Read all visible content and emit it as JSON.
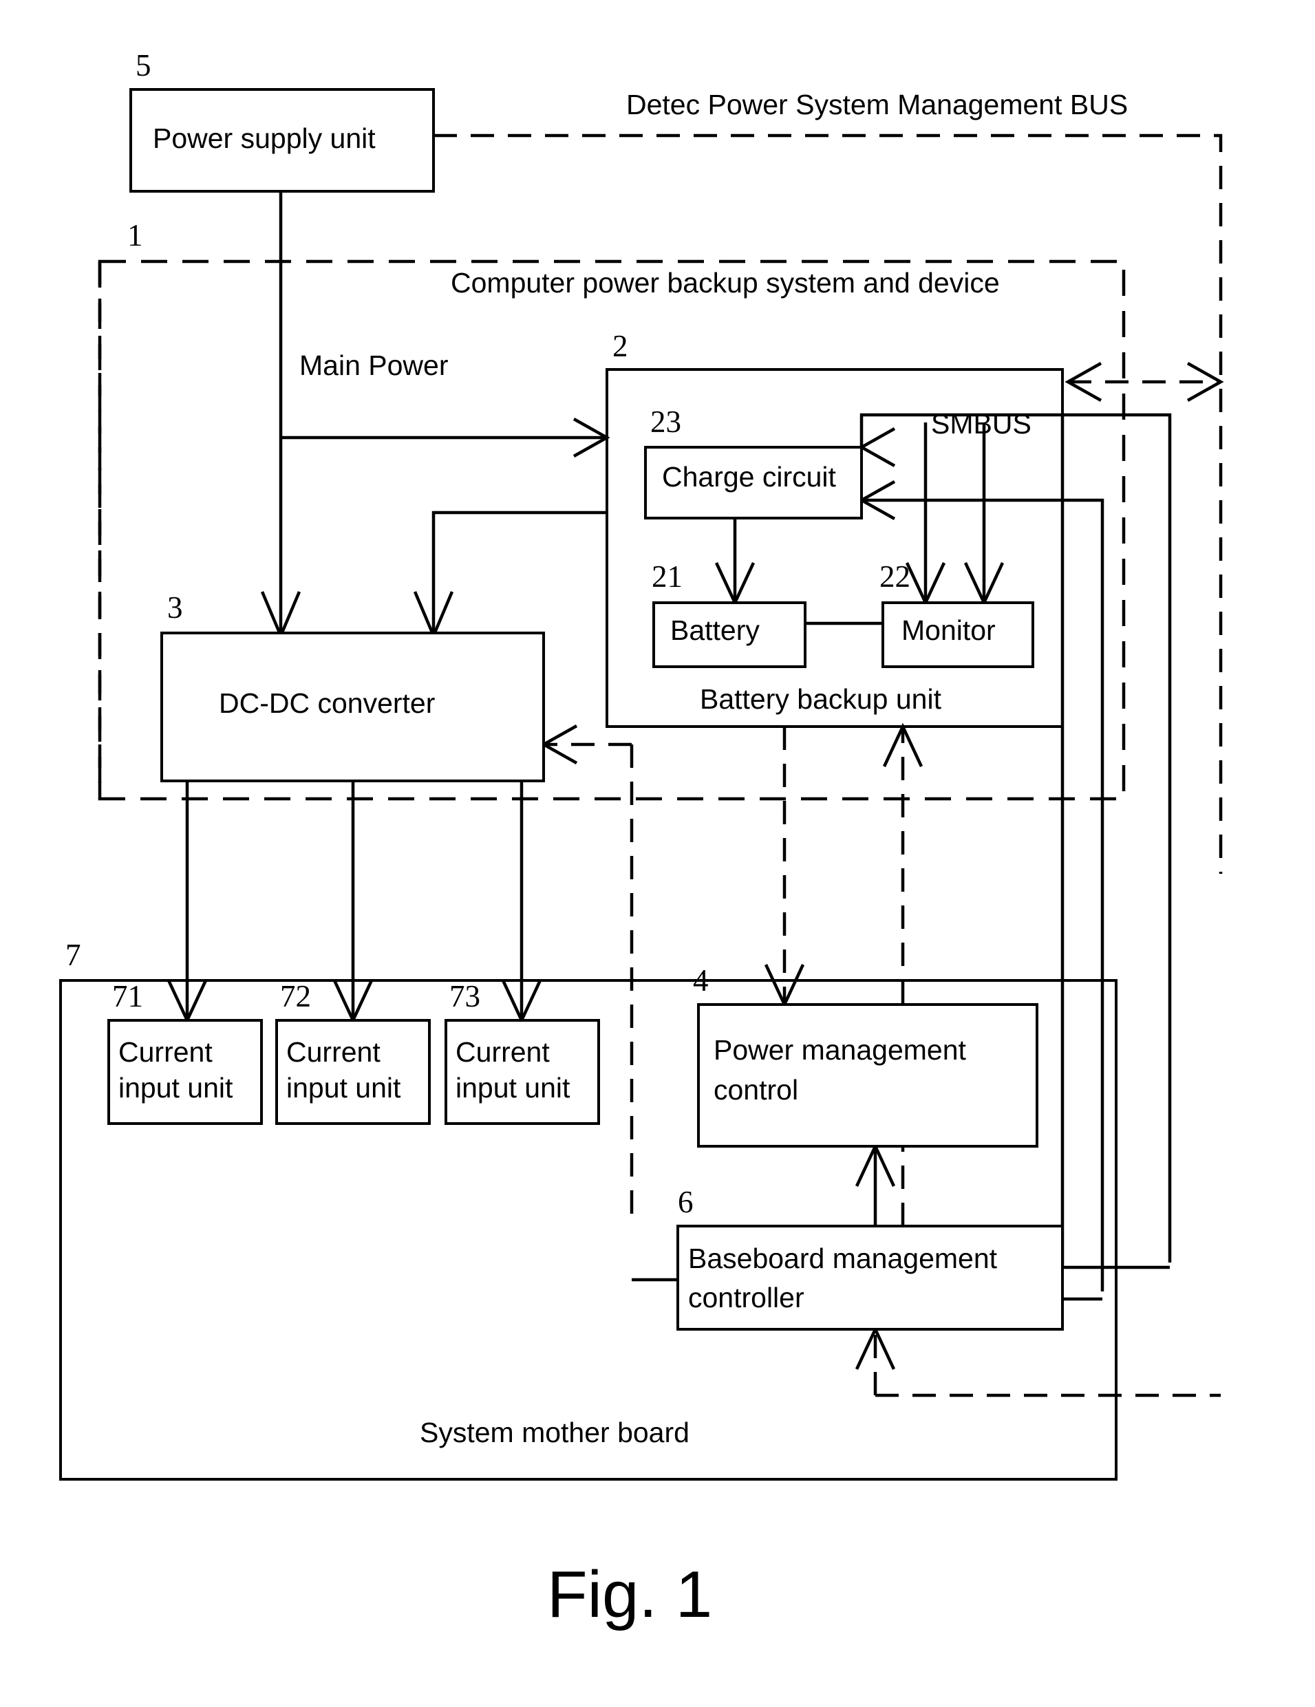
{
  "figure": {
    "caption": "Fig. 1",
    "title": "Computer power backup system and device block diagram"
  },
  "regions": [
    {
      "id": "region-1",
      "number": "1",
      "label": "Computer power backup system and device",
      "style": "dash-dot"
    },
    {
      "id": "region-2",
      "number": "2",
      "label": "Battery backup unit",
      "style": "solid"
    },
    {
      "id": "region-7",
      "number": "7",
      "label": "System mother board",
      "style": "solid"
    }
  ],
  "blocks": [
    {
      "id": "power-supply-unit",
      "number": "5",
      "label": "Power supply unit"
    },
    {
      "id": "charge-circuit",
      "number": "23",
      "label": "Charge circuit"
    },
    {
      "id": "battery",
      "number": "21",
      "label": "Battery"
    },
    {
      "id": "monitor",
      "number": "22",
      "label": "Monitor"
    },
    {
      "id": "dc-dc-converter",
      "number": "3",
      "label": "DC-DC converter"
    },
    {
      "id": "current-input-unit-71",
      "number": "71",
      "label": "Current input unit",
      "line1": "Current",
      "line2": "input unit"
    },
    {
      "id": "current-input-unit-72",
      "number": "72",
      "label": "Current input unit",
      "line1": "Current",
      "line2": "input unit"
    },
    {
      "id": "current-input-unit-73",
      "number": "73",
      "label": "Current input unit",
      "line1": "Current",
      "line2": "input unit"
    },
    {
      "id": "power-management-control",
      "number": "4",
      "label": "Power management control",
      "line1": "Power management",
      "line2": "control"
    },
    {
      "id": "baseboard-management-controller",
      "number": "6",
      "label": "Baseboard management controller",
      "line1": "Baseboard management",
      "line2": "controller"
    }
  ],
  "bus_labels": {
    "detect_bus": "Detec Power System Management BUS",
    "main_power": "Main Power",
    "smbus": "SMBUS"
  },
  "colors": {
    "stroke": "#000000",
    "background": "#ffffff"
  }
}
